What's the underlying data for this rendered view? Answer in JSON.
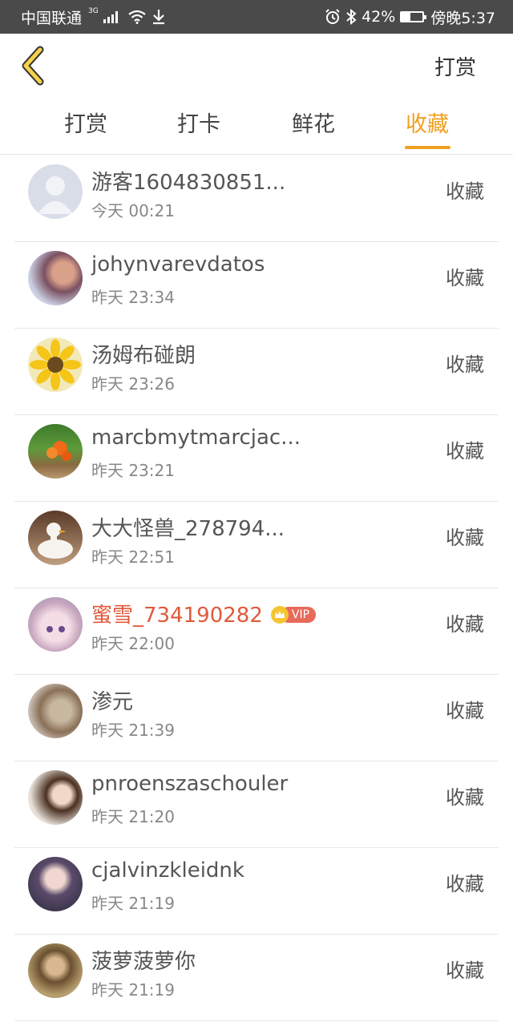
{
  "status_bar": {
    "carrier": "中国联通",
    "network": "3G",
    "battery": "42%",
    "battery_level": 0.42,
    "time": "傍晚5:37"
  },
  "header": {
    "back_icon": "chevron-left-icon",
    "action_label": "打赏"
  },
  "tabs": [
    {
      "label": "打赏",
      "active": false
    },
    {
      "label": "打卡",
      "active": false
    },
    {
      "label": "鲜花",
      "active": false
    },
    {
      "label": "收藏",
      "active": true
    }
  ],
  "colors": {
    "accent": "#f0a020",
    "vip_name": "#e05a3a",
    "status_bar_bg": "#4a4a4a"
  },
  "list": [
    {
      "name": "游客1604830851...",
      "time": "今天 00:21",
      "action": "收藏",
      "avatar": "default-user-avatar"
    },
    {
      "name": "johynvarevdatos",
      "time": "昨天 23:34",
      "action": "收藏",
      "avatar": "photo-avatar"
    },
    {
      "name": "汤姆布碰朗",
      "time": "昨天 23:26",
      "action": "收藏",
      "avatar": "sunflower-avatar"
    },
    {
      "name": "marcbmytmarcjac...",
      "time": "昨天 23:21",
      "action": "收藏",
      "avatar": "flower-avatar"
    },
    {
      "name": "大大怪兽_278794...",
      "time": "昨天 22:51",
      "action": "收藏",
      "avatar": "duck-avatar"
    },
    {
      "name": "蜜雪_734190282",
      "time": "昨天 22:00",
      "action": "收藏",
      "avatar": "anime-avatar",
      "vip": true,
      "vip_label": "VIP"
    },
    {
      "name": "渗元",
      "time": "昨天 21:39",
      "action": "收藏",
      "avatar": "photo-avatar"
    },
    {
      "name": "pnroenszaschouler",
      "time": "昨天 21:20",
      "action": "收藏",
      "avatar": "photo-avatar"
    },
    {
      "name": "cjalvinzkleidnk",
      "time": "昨天 21:19",
      "action": "收藏",
      "avatar": "photo-avatar"
    },
    {
      "name": "菠萝菠萝你",
      "time": "昨天 21:19",
      "action": "收藏",
      "avatar": "painting-avatar"
    }
  ]
}
